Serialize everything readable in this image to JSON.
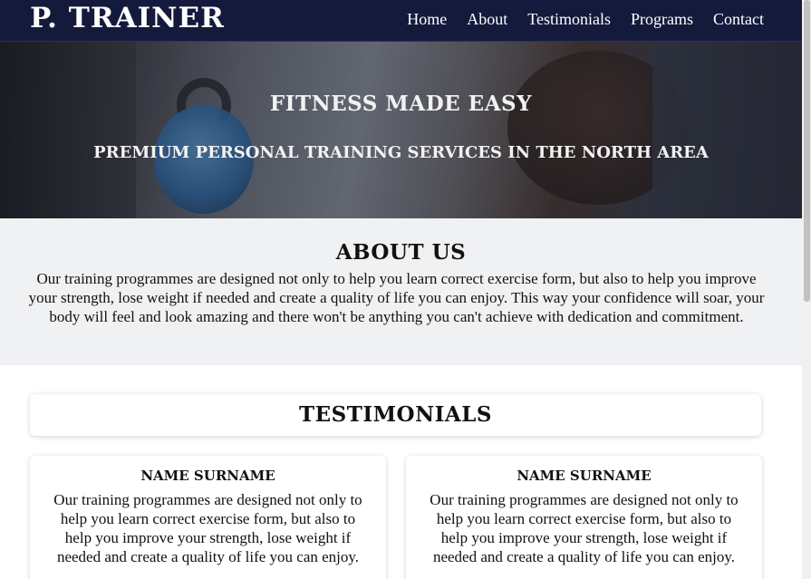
{
  "navbar": {
    "brand": "P. TRAINER",
    "links": [
      "Home",
      "About",
      "Testimonials",
      "Programs",
      "Contact"
    ]
  },
  "hero": {
    "title": "FITNESS MADE EASY",
    "subtitle": "PREMIUM PERSONAL TRAINING SERVICES IN THE NORTH AREA"
  },
  "about": {
    "heading": "ABOUT US",
    "text": "Our training programmes are designed not only to help you learn correct exercise form, but also to help you improve your strength, lose weight if needed and create a quality of life you can enjoy. This way your confidence will soar, your body will feel and look amazing and there won't be anything you can't achieve with dedication and commitment."
  },
  "testimonials": {
    "heading": "TESTIMONIALS",
    "items": [
      {
        "name": "NAME SURNAME",
        "text": "Our training programmes are designed not only to help you learn correct exercise form, but also to help you improve your strength, lose weight if needed and create a quality of life you can enjoy."
      },
      {
        "name": "NAME SURNAME",
        "text": "Our training programmes are designed not only to help you learn correct exercise form, but also to help you improve your strength, lose weight if needed and create a quality of life you can enjoy."
      }
    ]
  },
  "colors": {
    "navbar_bg": "#141a3c",
    "about_bg": "#f0f1f3",
    "text": "#111111"
  }
}
